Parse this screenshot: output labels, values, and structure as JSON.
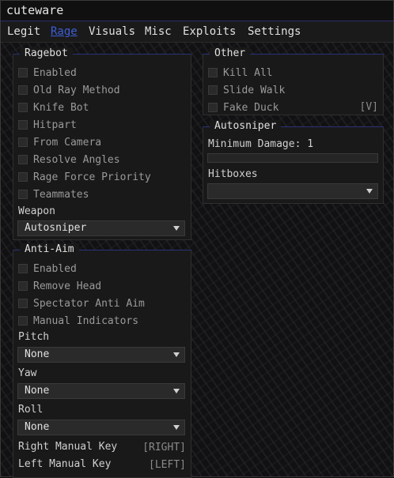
{
  "app": {
    "title": "cuteware"
  },
  "menu": [
    {
      "label": "Legit"
    },
    {
      "label": "Rage"
    },
    {
      "label": "Visuals"
    },
    {
      "label": "Misc"
    },
    {
      "label": "Exploits"
    },
    {
      "label": "Settings"
    }
  ],
  "ragebot": {
    "title": "Ragebot",
    "options": [
      {
        "label": "Enabled"
      },
      {
        "label": "Old Ray Method"
      },
      {
        "label": "Knife Bot"
      },
      {
        "label": "Hitpart"
      },
      {
        "label": "From Camera"
      },
      {
        "label": "Resolve Angles"
      },
      {
        "label": "Rage Force Priority"
      },
      {
        "label": "Teammates"
      }
    ],
    "weapon_label": "Weapon",
    "weapon_value": "Autosniper"
  },
  "antiaim": {
    "title": "Anti-Aim",
    "options": [
      {
        "label": "Enabled"
      },
      {
        "label": "Remove Head"
      },
      {
        "label": "Spectator Anti Aim"
      },
      {
        "label": "Manual Indicators"
      }
    ],
    "pitch_label": "Pitch",
    "pitch_value": "None",
    "yaw_label": "Yaw",
    "yaw_value": "None",
    "roll_label": "Roll",
    "roll_value": "None",
    "right_key_label": "Right Manual Key",
    "right_key_value": "[RIGHT]",
    "left_key_label": "Left Manual Key",
    "left_key_value": "[LEFT]"
  },
  "other": {
    "title": "Other",
    "options": [
      {
        "label": "Kill All"
      },
      {
        "label": "Slide Walk"
      },
      {
        "label": "Fake Duck",
        "key": "[V]"
      }
    ]
  },
  "autosniper": {
    "title": "Autosniper",
    "min_damage_label": "Minimum Damage: 1",
    "min_damage_value": 1,
    "hitboxes_label": "Hitboxes",
    "hitboxes_value": ""
  }
}
